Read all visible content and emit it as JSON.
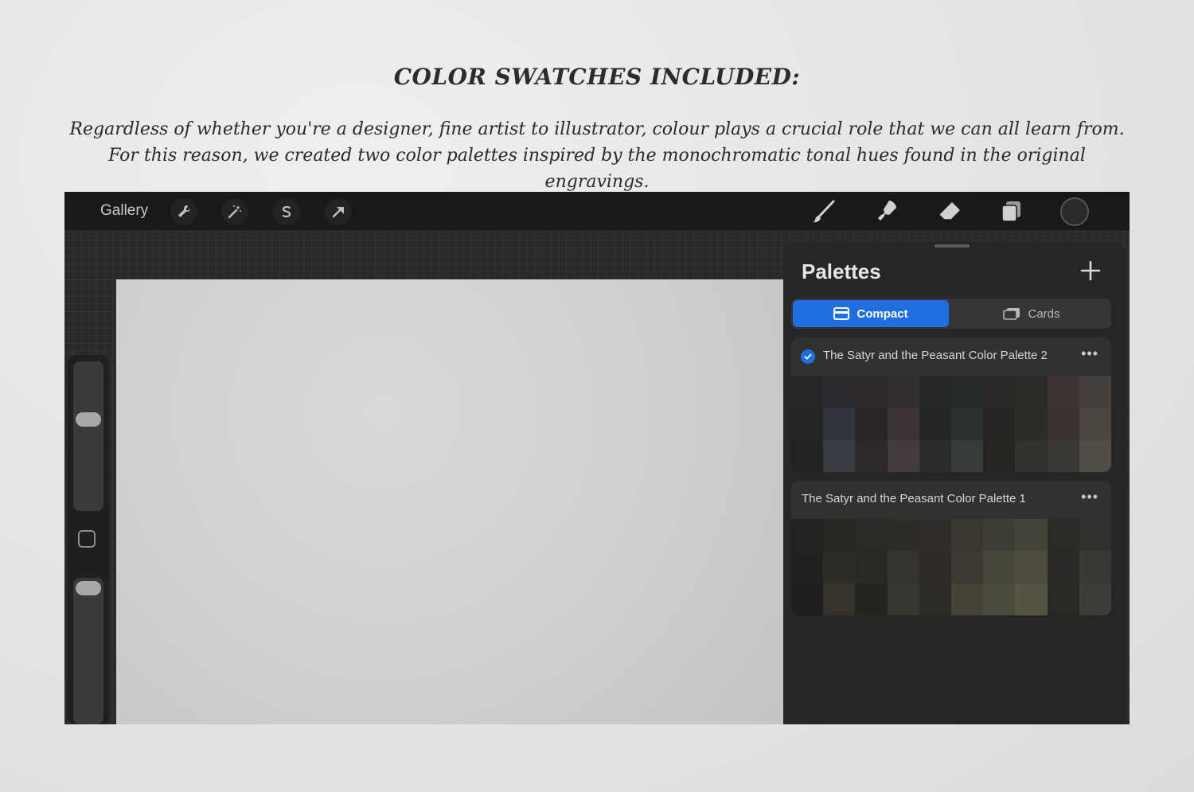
{
  "heading": "COLOR SWATCHES INCLUDED:",
  "intro": "Regardless of whether you're a designer, fine artist to illustrator, colour plays a crucial role that we can all learn from. For this reason, we created two color palettes inspired by the monochromatic tonal hues found in the original engravings.",
  "toolbar": {
    "gallery": "Gallery",
    "left_tools": [
      "wrench-icon",
      "magic-wand-icon",
      "selection-icon",
      "transform-arrow-icon"
    ],
    "right_tools": [
      "brush-icon",
      "smudge-icon",
      "eraser-icon",
      "layers-icon",
      "color-well"
    ]
  },
  "panel": {
    "title": "Palettes",
    "add_icon": "plus-icon",
    "tabs": [
      {
        "label": "Compact",
        "active": true,
        "icon": "compact-icon"
      },
      {
        "label": "Cards",
        "active": false,
        "icon": "cards-icon"
      }
    ],
    "palettes": [
      {
        "name": "The Satyr and the Peasant Color Palette 2",
        "default": true,
        "more": "•••",
        "colors": [
          "#272727",
          "#2b2c30",
          "#2e2a2a",
          "#332d2e",
          "#262826",
          "#262b28",
          "#2a2826",
          "#2b2a27",
          "#3b3432",
          "#45403c",
          "#242425",
          "#31333a",
          "#2b2626",
          "#3a3234",
          "#232523",
          "#2c322e",
          "#262422",
          "#2e2c29",
          "#393230",
          "#4c4641",
          "#222223",
          "#3b3d44",
          "#2e2929",
          "#433b3d",
          "#2a2d2b",
          "#353c37",
          "#262421",
          "#33312d",
          "#3a3835",
          "#524c46"
        ]
      },
      {
        "name": "The Satyr and the Peasant Color Palette 1",
        "default": false,
        "more": "•••",
        "colors": [
          "#232220",
          "#282722",
          "#2b2a26",
          "#2d2c27",
          "#312d2a",
          "#3a3630",
          "#3f3e34",
          "#45443a",
          "#2b2a27",
          "#33312d",
          "#222120",
          "#2e2c27",
          "#292a24",
          "#333330",
          "#2e2a28",
          "#3d3a34",
          "#47463a",
          "#4c4b3e",
          "#2a2927",
          "#3a3834",
          "#1f1e1c",
          "#37332c",
          "#23241f",
          "#363730",
          "#2b2a26",
          "#454238",
          "#4a4a3c",
          "#555442",
          "#282825",
          "#3f3d39"
        ]
      }
    ]
  },
  "colors": {
    "accent": "#1f6fe0",
    "toolbar_bg": "#191919",
    "panel_bg": "#262626"
  }
}
